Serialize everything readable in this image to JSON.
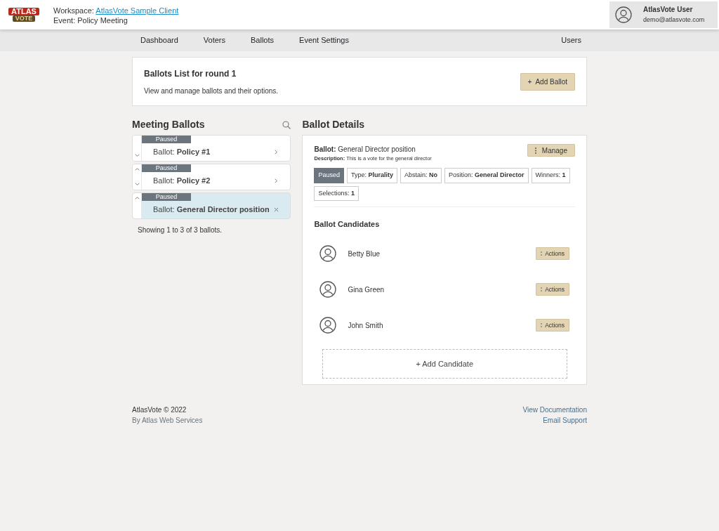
{
  "header": {
    "logo_text": [
      "ATLAS",
      "VOTE"
    ],
    "workspace_label": "Workspace:",
    "workspace_link": "AtlasVote Sample Client",
    "event": "Event: Policy Meeting",
    "user": {
      "name": "AtlasVote User",
      "email": "demo@atlasvote.com"
    }
  },
  "nav": {
    "items": [
      "Dashboard",
      "Voters",
      "Ballots",
      "Event Settings"
    ],
    "right_items": [
      "Users"
    ]
  },
  "list_header": {
    "title": "Ballots List for round 1",
    "subtitle": "View and manage ballots and their options.",
    "button": "+  Add Ballot"
  },
  "meeting_ballots": {
    "title": "Meeting Ballots",
    "items": [
      {
        "status": "Paused",
        "text": "Ballot: **Policy #1**",
        "selected": false,
        "can_move_up": false,
        "can_move_down": true
      },
      {
        "status": "Paused",
        "text": "Ballot: **Policy #2**",
        "selected": false,
        "can_move_up": true,
        "can_move_down": true
      },
      {
        "status": "Paused",
        "text": "Ballot: **General Director position**",
        "selected": true,
        "can_move_up": true,
        "can_move_down": false
      }
    ],
    "footer": "Showing 1 to 3 of 3 ballots."
  },
  "ballot_details": {
    "title": "Ballot Details",
    "ballot": "**Ballot:** General Director position",
    "description": "**Description:** This is a vote for the general director",
    "manage_button": "Manage",
    "tags": [
      {
        "kind": "status",
        "text": "Paused"
      },
      {
        "kind": "info",
        "text": "Type: **Plurality**"
      },
      {
        "kind": "info",
        "text": "Abstain: **No**"
      },
      {
        "kind": "info",
        "text": "Position: **General Director**"
      },
      {
        "kind": "info",
        "text": "Winners: **1**"
      },
      {
        "kind": "info",
        "text": "Selections: **1**"
      }
    ],
    "candidates_title": "Ballot Candidates",
    "candidates": [
      {
        "name": "Betty Blue",
        "action": "Actions"
      },
      {
        "name": "Gina Green",
        "action": "Actions"
      },
      {
        "name": "John Smith",
        "action": "Actions"
      }
    ],
    "add_candidate": "+ Add Candidate"
  },
  "footer": {
    "copyright": "AtlasVote © 2022",
    "by": "By Atlas Web Services",
    "links": [
      "View Documentation",
      "Email Support"
    ]
  }
}
